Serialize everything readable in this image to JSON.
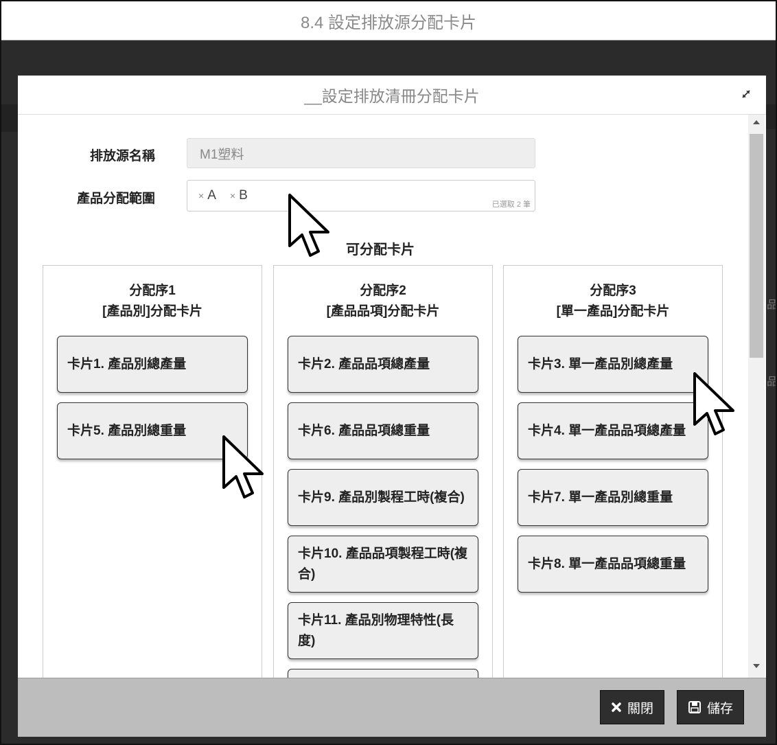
{
  "page": {
    "title": "8.4 設定排放源分配卡片"
  },
  "background": {
    "side_text_1": "品",
    "side_text_2": "品"
  },
  "modal": {
    "title": "__設定排放清冊分配卡片",
    "form": {
      "source_label": "排放源名稱",
      "source_value": "M1塑料",
      "range_label": "產品分配範圍",
      "tags": [
        "A",
        "B"
      ],
      "tag_remove_symbol": "×",
      "selected_count": "已選取 2 筆"
    },
    "cards_title": "可分配卡片",
    "columns": [
      {
        "title_line1": "分配序1",
        "title_line2": "[產品別]分配卡片",
        "cards": [
          "卡片1. 產品別總產量",
          "卡片5. 產品別總重量"
        ]
      },
      {
        "title_line1": "分配序2",
        "title_line2": "[產品品項]分配卡片",
        "cards": [
          "卡片2. 產品品項總產量",
          "卡片6. 產品品項總重量",
          "卡片9. 產品別製程工時(複合)",
          "卡片10. 產品品項製程工時(複合)",
          "卡片11. 產品別物理特性(長度)"
        ]
      },
      {
        "title_line1": "分配序3",
        "title_line2": "[單一產品]分配卡片",
        "cards": [
          "卡片3. 單一產品別總產量",
          "卡片4. 單一產品品項總產量",
          "卡片7. 單一產品別總重量",
          "卡片8. 單一產品品項總重量"
        ]
      }
    ],
    "footer": {
      "close_label": "關閉",
      "save_label": "儲存"
    }
  },
  "icons": {
    "expand": "expand-icon",
    "close": "close-x-icon",
    "save": "floppy-disk-icon",
    "cursor": "mouse-pointer-icon"
  },
  "colors": {
    "button_bg": "#2e2e2e",
    "footer_bg": "#bdbdbd",
    "card_bg": "#eeeeee"
  }
}
